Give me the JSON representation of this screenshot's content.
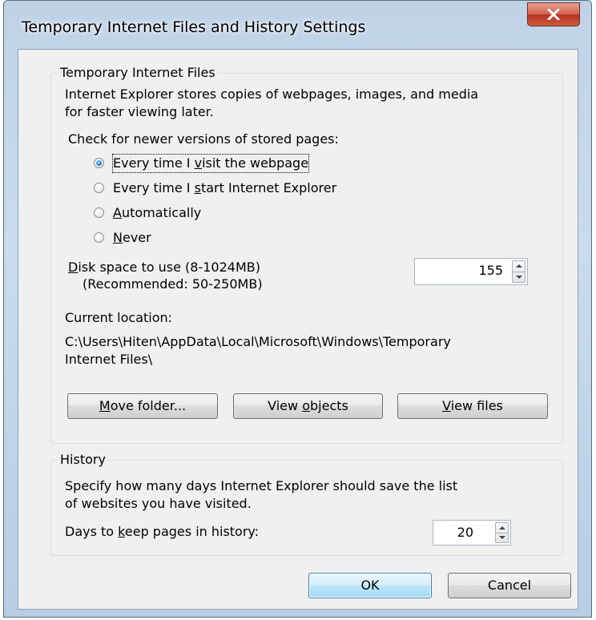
{
  "window": {
    "title": "Temporary Internet Files and History Settings",
    "close_symbol": "x"
  },
  "tif": {
    "group_label": "Temporary Internet Files",
    "desc_line1": "Internet Explorer stores copies of webpages, images, and media",
    "desc_line2": "for faster viewing later.",
    "check_label": "Check for newer versions of stored pages:",
    "options": [
      {
        "label": "Every time I visit the webpage",
        "checked": true
      },
      {
        "label": "Every time I start Internet Explorer",
        "checked": false
      },
      {
        "label": "Automatically",
        "checked": false
      },
      {
        "label": "Never",
        "checked": false
      }
    ],
    "disk_label_line1": "Disk space to use (8-1024MB)",
    "disk_label_line2": "(Recommended: 50-250MB)",
    "disk_value": "155",
    "location_label": "Current location:",
    "location_line1": "C:\\Users\\Hiten\\AppData\\Local\\Microsoft\\Windows\\Temporary",
    "location_line2": "Internet Files\\",
    "buttons": {
      "move_folder": "Move folder...",
      "view_objects": "View objects",
      "view_files": "View files"
    }
  },
  "history": {
    "group_label": "History",
    "desc_line1": "Specify how many days Internet Explorer should save the list",
    "desc_line2": "of websites you have visited.",
    "days_label": "Days to keep pages in history:",
    "days_value": "20"
  },
  "footer": {
    "ok": "OK",
    "cancel": "Cancel"
  },
  "colors": {
    "accent": "#3c7fb1",
    "close_button": "#c94a33",
    "frame": "#c5d8ec"
  },
  "icons": [
    "close-icon",
    "radio-icon",
    "spin-up-icon",
    "spin-down-icon"
  ]
}
